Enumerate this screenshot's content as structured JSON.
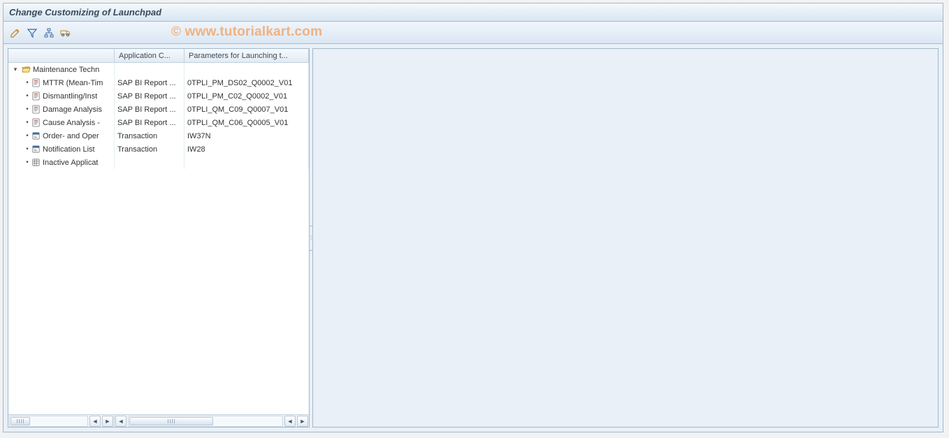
{
  "title": "Change Customizing of Launchpad",
  "watermark": "© www.tutorialkart.com",
  "toolbar": {
    "btn1": "edit-icon",
    "btn2": "check-icon",
    "btn3": "activate-icon",
    "btn4": "transport-icon"
  },
  "columns": {
    "tree": "",
    "appcat": "Application C...",
    "params": "Parameters for Launching t..."
  },
  "tree": {
    "root": {
      "label": "Maintenance Techn",
      "icon": "folder-open-icon",
      "expanded": true
    },
    "children": [
      {
        "label": "MTTR (Mean-Tim",
        "icon": "report-icon",
        "appcat": "SAP BI Report ...",
        "params": "0TPLI_PM_DS02_Q0002_V01"
      },
      {
        "label": "Dismantling/Inst",
        "icon": "report-icon",
        "appcat": "SAP BI Report ...",
        "params": "0TPLI_PM_C02_Q0002_V01"
      },
      {
        "label": "Damage Analysis",
        "icon": "report-icon",
        "appcat": "SAP BI Report ...",
        "params": "0TPLI_QM_C09_Q0007_V01"
      },
      {
        "label": "Cause Analysis -",
        "icon": "report-icon",
        "appcat": "SAP BI Report ...",
        "params": "0TPLI_QM_C06_Q0005_V01"
      },
      {
        "label": "Order- and Oper",
        "icon": "transaction-icon",
        "appcat": "Transaction",
        "params": "IW37N"
      },
      {
        "label": "Notification List",
        "icon": "transaction-icon",
        "appcat": "Transaction",
        "params": "IW28"
      },
      {
        "label": "Inactive Applicat",
        "icon": "inactive-folder-icon",
        "appcat": "",
        "params": ""
      }
    ]
  }
}
